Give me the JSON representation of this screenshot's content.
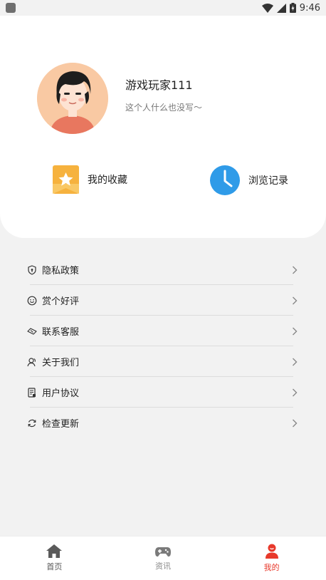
{
  "status_bar": {
    "time": "9:46",
    "icons": [
      "app-notification-icon",
      "wifi-icon",
      "cellular-signal-icon",
      "battery-charging-icon"
    ]
  },
  "profile": {
    "username": "游戏玩家111",
    "bio": "这个人什么也没写～",
    "avatar_icon": "avatar-illustration"
  },
  "shortcuts": [
    {
      "label": "我的收藏",
      "icon": "bookmark-star-icon",
      "color": "#f6b23e"
    },
    {
      "label": "浏览记录",
      "icon": "clock-icon",
      "color": "#2f9be8"
    }
  ],
  "menu": [
    {
      "label": "隐私政策",
      "icon": "shield-icon"
    },
    {
      "label": "赏个好评",
      "icon": "smile-icon"
    },
    {
      "label": "联系客服",
      "icon": "handshake-icon"
    },
    {
      "label": "关于我们",
      "icon": "people-icon"
    },
    {
      "label": "用户协议",
      "icon": "document-icon"
    },
    {
      "label": "检查更新",
      "icon": "refresh-icon"
    }
  ],
  "bottom_nav": {
    "items": [
      {
        "label": "首页",
        "icon": "home-icon",
        "active": false
      },
      {
        "label": "资讯",
        "icon": "gamepad-icon",
        "active": false
      },
      {
        "label": "我的",
        "icon": "user-icon",
        "active": true
      }
    ],
    "active_color": "#e8392b",
    "inactive_color": "#555555"
  }
}
